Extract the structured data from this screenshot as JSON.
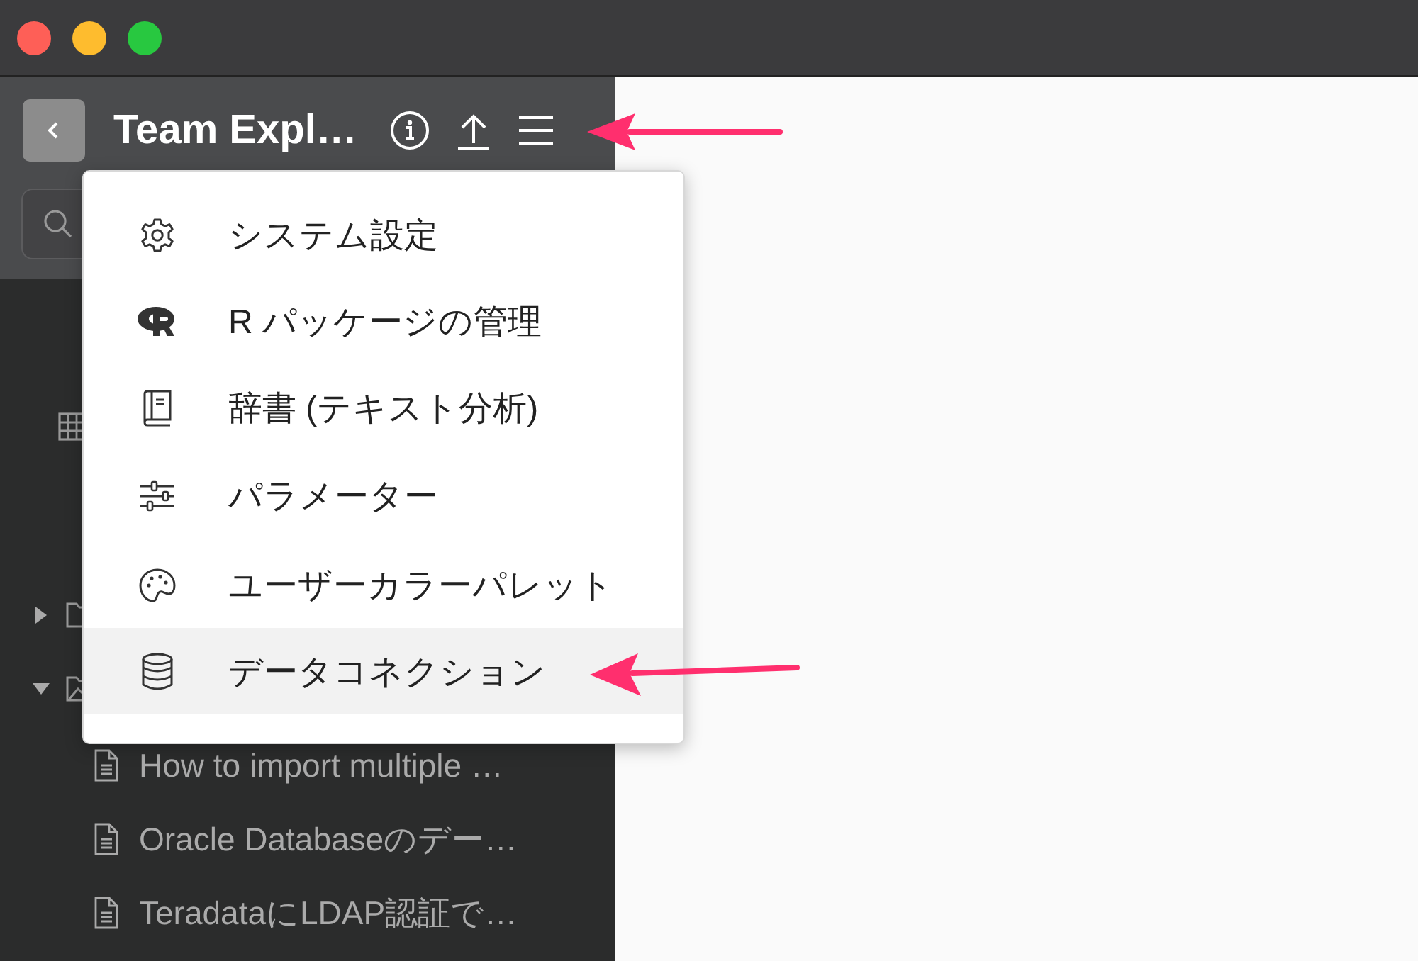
{
  "header": {
    "title": "Team Expl…"
  },
  "tree": [
    {
      "kind": "folder",
      "expanded": false
    },
    {
      "kind": "image-folder",
      "expanded": true,
      "children": [
        {
          "label": "How to import multiple …"
        },
        {
          "label": "Oracle Databaseのデー…"
        },
        {
          "label": "TeradataにLDAP認証で…"
        }
      ]
    }
  ],
  "menu": [
    {
      "label": "システム設定",
      "selected": false
    },
    {
      "label": "R パッケージの管理",
      "selected": false
    },
    {
      "label": "辞書 (テキスト分析)",
      "selected": false
    },
    {
      "label": "パラメーター",
      "selected": false
    },
    {
      "label": "ユーザーカラーパレット",
      "selected": false
    },
    {
      "label": "データコネクション",
      "selected": true
    }
  ]
}
